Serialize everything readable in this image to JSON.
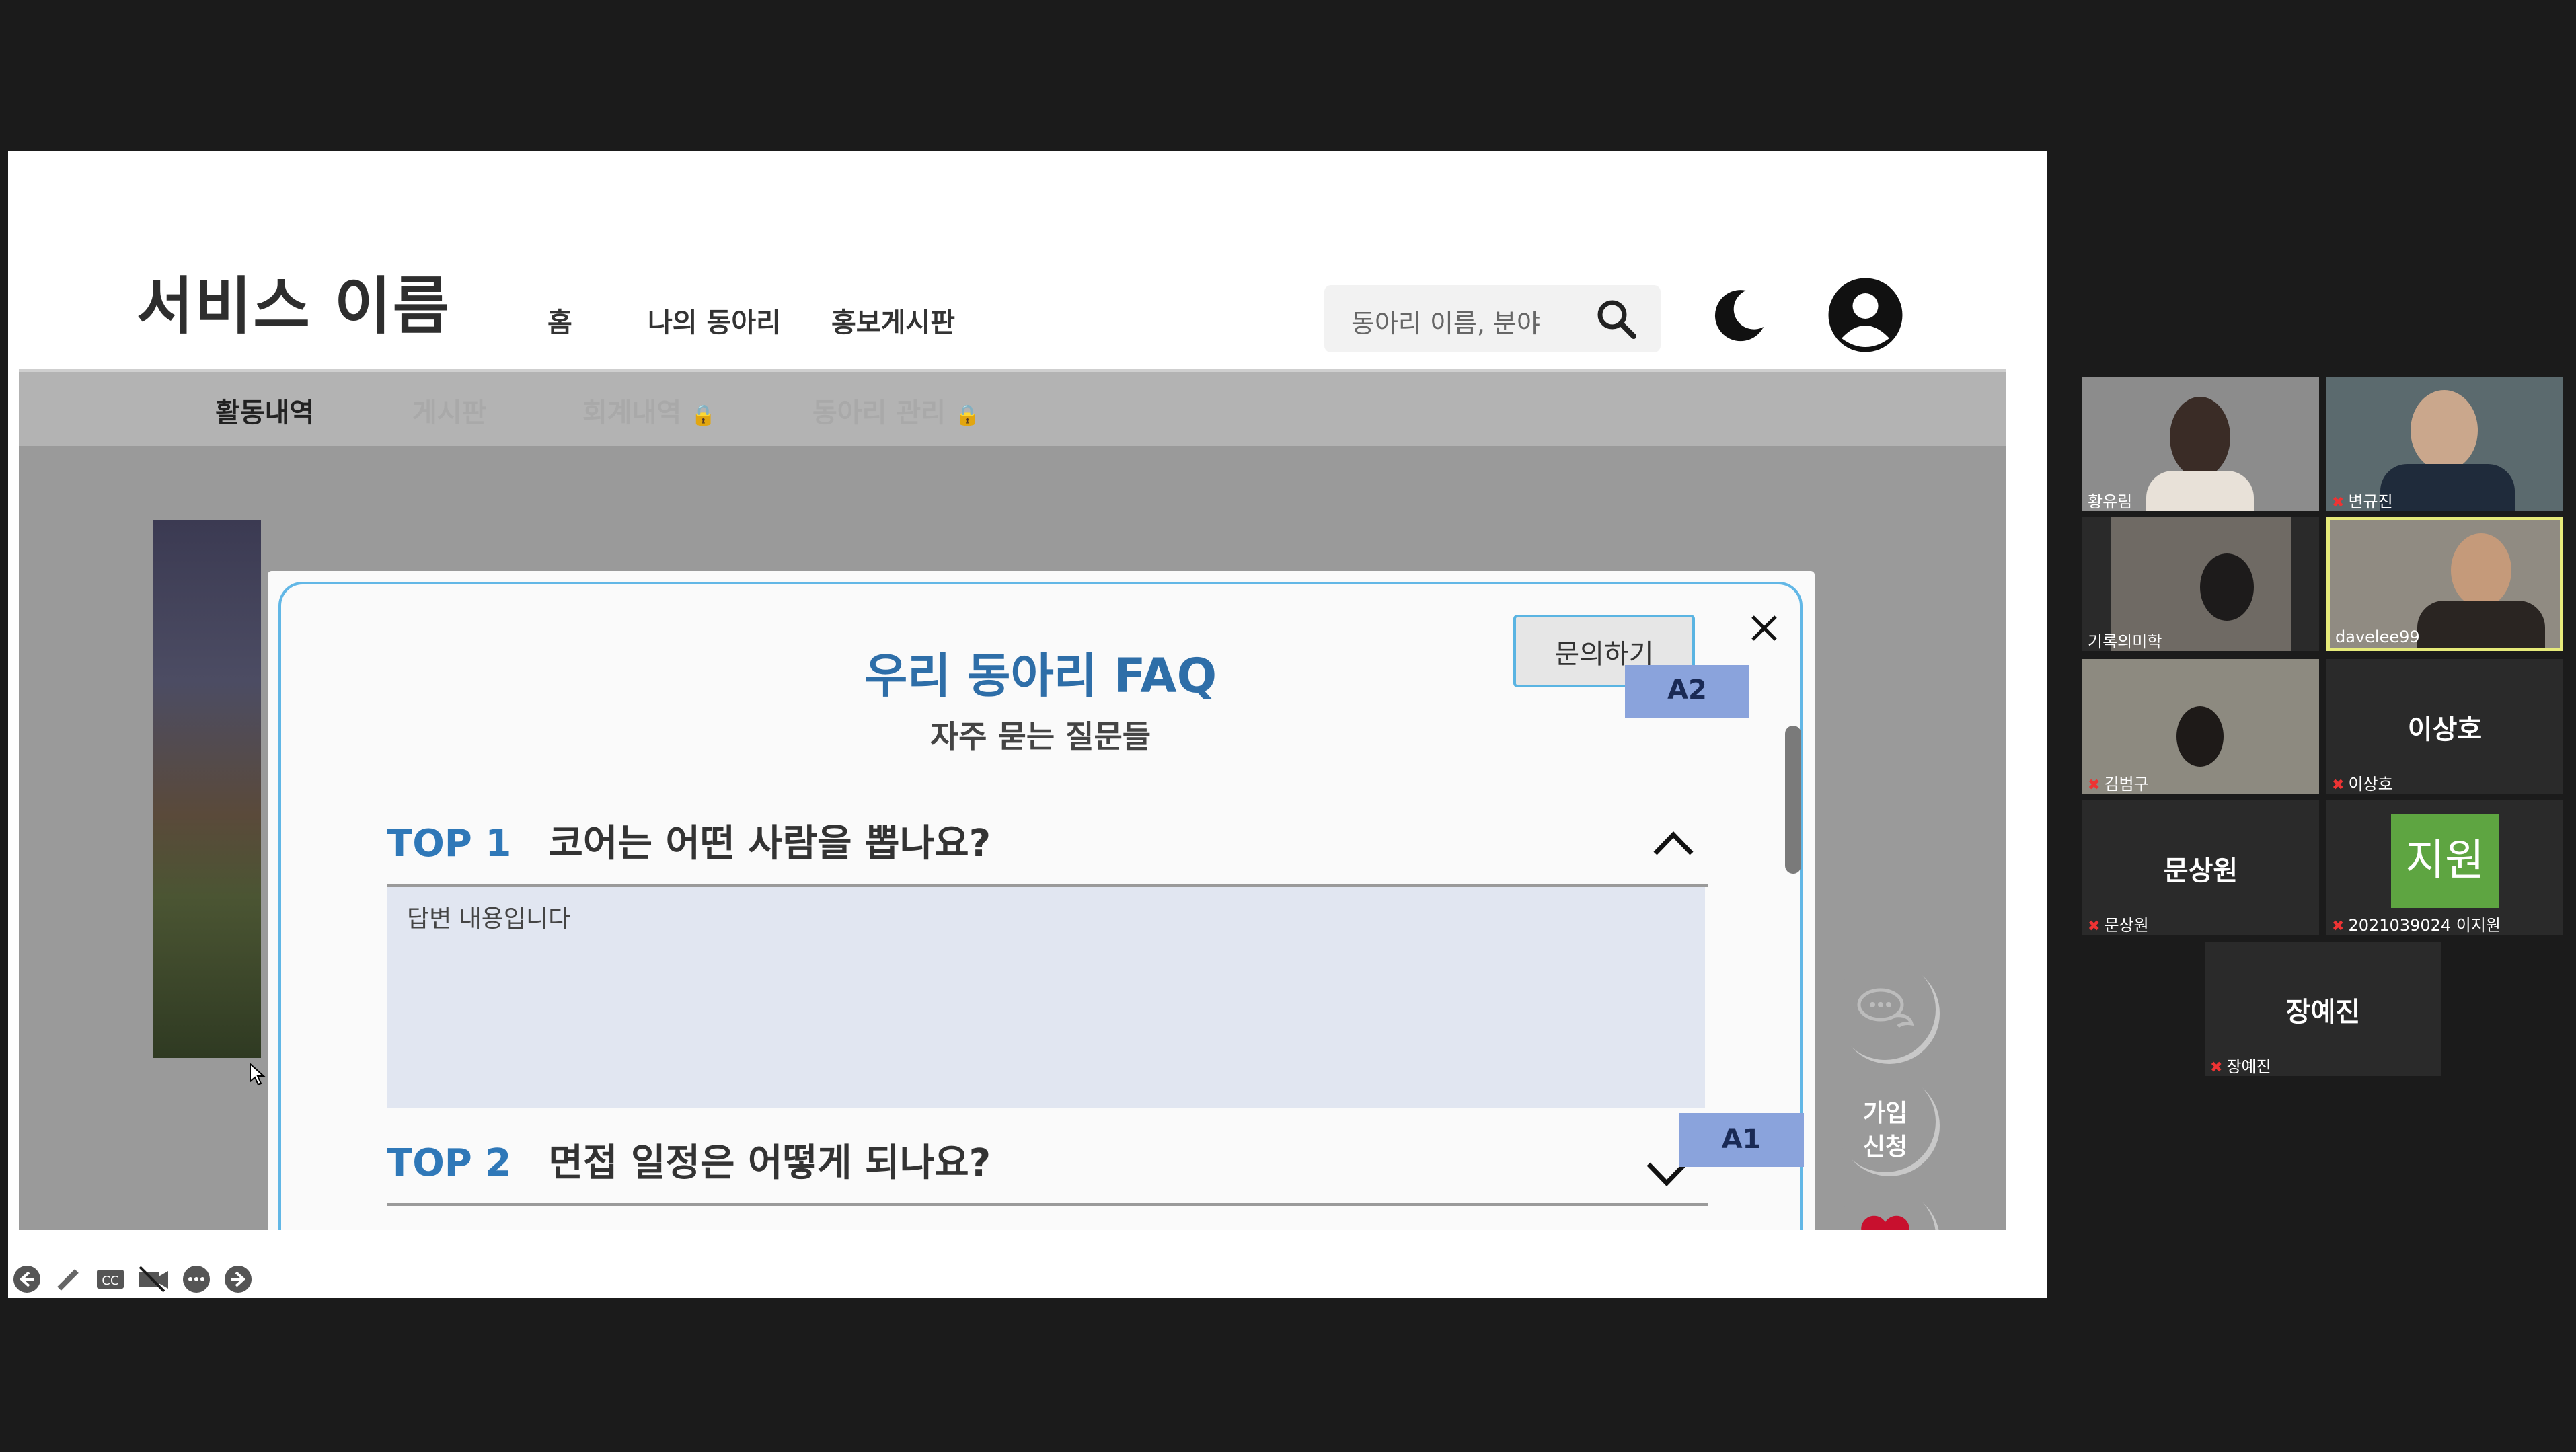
{
  "site": {
    "service_name": "서비스 이름",
    "nav": [
      "홈",
      "나의 동아리",
      "홍보게시판"
    ],
    "search_placeholder": "동아리 이름, 분야",
    "tabs": [
      {
        "label": "활동내역",
        "locked": false,
        "active": true
      },
      {
        "label": "게시판",
        "locked": false,
        "active": false
      },
      {
        "label": "회계내역",
        "locked": true,
        "active": false
      },
      {
        "label": "동아리 관리",
        "locked": true,
        "active": false
      }
    ]
  },
  "modal": {
    "title": "우리 동아리 FAQ",
    "subtitle": "자주 묻는 질문들",
    "inquiry_button": "문의하기",
    "tag_a2": "A2",
    "tag_a1": "A1",
    "faqs": [
      {
        "rank": "TOP 1",
        "question": "코어는 어떤 사람을 뽑나요?",
        "answer": "답변 내용입니다",
        "expanded": true
      },
      {
        "rank": "TOP 2",
        "question": "면접 일정은 어떻게 되나요?",
        "expanded": false
      }
    ]
  },
  "floating": {
    "join_line1": "가입",
    "join_line2": "신청"
  },
  "colors": {
    "accent_blue": "#2f78b8",
    "modal_border": "#62b7e6",
    "tag_bg": "#8aa3dc",
    "heart": "#c8102e"
  },
  "participants": [
    {
      "name": "황유림",
      "muted": false,
      "video": true
    },
    {
      "name": "변규진",
      "muted": true,
      "video": true
    },
    {
      "name": "기록의미학",
      "muted": false,
      "video": true
    },
    {
      "name": "davelee99",
      "muted": false,
      "video": true,
      "speaking": true
    },
    {
      "name": "김범구",
      "muted": true,
      "video": true
    },
    {
      "name": "이상호",
      "muted": true,
      "video": false
    },
    {
      "name": "문상원",
      "muted": true,
      "video": false
    },
    {
      "name": "2021039024 이지원",
      "muted": true,
      "video": false,
      "avatar_text": "지원"
    },
    {
      "name": "장예진",
      "muted": true,
      "video": false
    }
  ]
}
